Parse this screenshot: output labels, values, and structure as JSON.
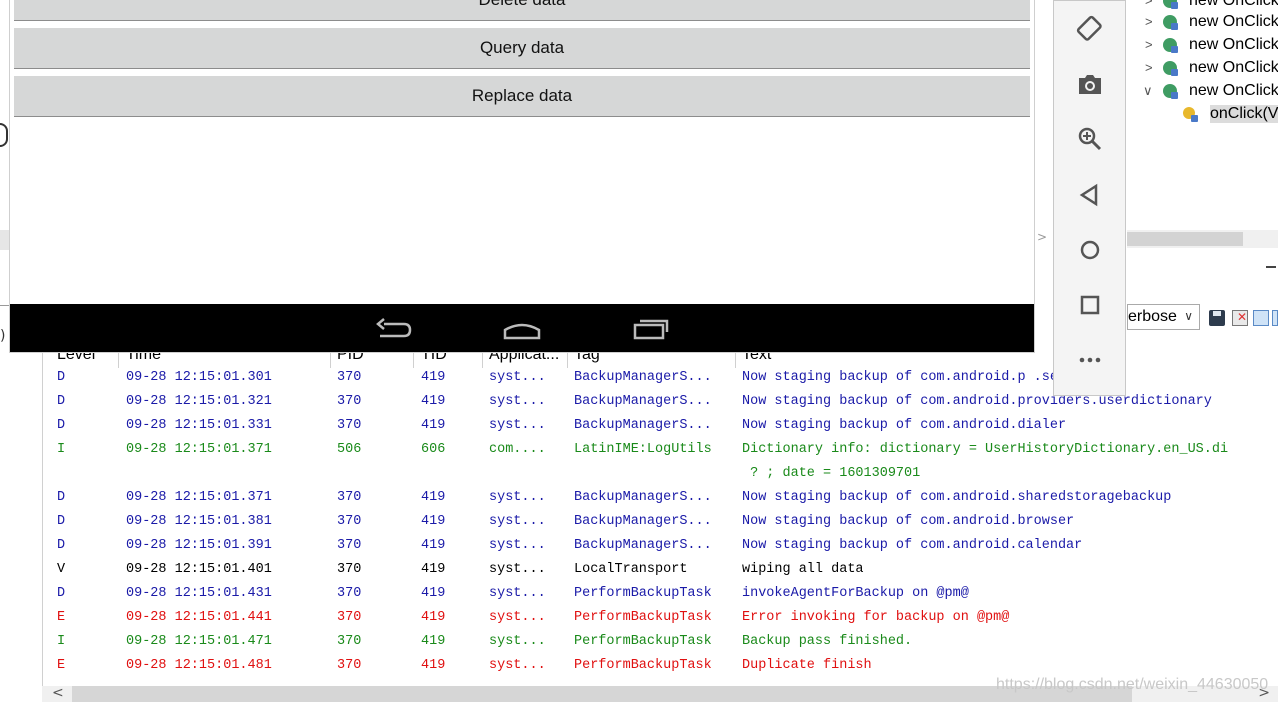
{
  "emulator": {
    "buttons": [
      {
        "label": "Delete data"
      },
      {
        "label": "Query data"
      },
      {
        "label": "Replace data"
      }
    ],
    "nav": [
      "back-icon",
      "home-icon",
      "recents-icon"
    ],
    "toolbar_icons": [
      "rotate-icon",
      "camera-icon",
      "zoom-icon",
      "back-triangle-icon",
      "home-circle-icon",
      "overview-square-icon",
      "more-icon"
    ]
  },
  "outline": {
    "items": [
      {
        "label": "new OnClick",
        "expanded": false
      },
      {
        "label": "new OnClick",
        "expanded": false
      },
      {
        "label": "new OnClick",
        "expanded": false
      },
      {
        "label": "new OnClick",
        "expanded": false
      },
      {
        "label": "new OnClick",
        "expanded": true
      },
      {
        "label": "onClick(V",
        "child": true
      }
    ]
  },
  "logcat": {
    "level_select": "erbose",
    "columns": [
      "Level",
      "Time",
      "PID",
      "TID",
      "Applicat...",
      "Tag",
      "Text"
    ],
    "rows": [
      {
        "level": "D",
        "time": "09-28 12:15:01.301",
        "pid": "370",
        "tid": "419",
        "app": "syst...",
        "tag": "BackupManagerS...",
        "text": "Now staging backup of com.android.p        .settings"
      },
      {
        "level": "D",
        "time": "09-28 12:15:01.321",
        "pid": "370",
        "tid": "419",
        "app": "syst...",
        "tag": "BackupManagerS...",
        "text": "Now staging backup of com.android.providers.userdictionary"
      },
      {
        "level": "D",
        "time": "09-28 12:15:01.331",
        "pid": "370",
        "tid": "419",
        "app": "syst...",
        "tag": "BackupManagerS...",
        "text": "Now staging backup of com.android.dialer"
      },
      {
        "level": "I",
        "time": "09-28 12:15:01.371",
        "pid": "506",
        "tid": "606",
        "app": "com....",
        "tag": "LatinIME:LogUtils",
        "text": "Dictionary info: dictionary = UserHistoryDictionary.en_US.di",
        "text2": " ? ; date = 1601309701"
      },
      {
        "level": "D",
        "time": "09-28 12:15:01.371",
        "pid": "370",
        "tid": "419",
        "app": "syst...",
        "tag": "BackupManagerS...",
        "text": "Now staging backup of com.android.sharedstoragebackup"
      },
      {
        "level": "D",
        "time": "09-28 12:15:01.381",
        "pid": "370",
        "tid": "419",
        "app": "syst...",
        "tag": "BackupManagerS...",
        "text": "Now staging backup of com.android.browser"
      },
      {
        "level": "D",
        "time": "09-28 12:15:01.391",
        "pid": "370",
        "tid": "419",
        "app": "syst...",
        "tag": "BackupManagerS...",
        "text": "Now staging backup of com.android.calendar"
      },
      {
        "level": "V",
        "time": "09-28 12:15:01.401",
        "pid": "370",
        "tid": "419",
        "app": "syst...",
        "tag": "LocalTransport",
        "text": "wiping all data"
      },
      {
        "level": "D",
        "time": "09-28 12:15:01.431",
        "pid": "370",
        "tid": "419",
        "app": "syst...",
        "tag": "PerformBackupTask",
        "text": "invokeAgentForBackup on @pm@"
      },
      {
        "level": "E",
        "time": "09-28 12:15:01.441",
        "pid": "370",
        "tid": "419",
        "app": "syst...",
        "tag": "PerformBackupTask",
        "text": "Error invoking for backup on @pm@"
      },
      {
        "level": "I",
        "time": "09-28 12:15:01.471",
        "pid": "370",
        "tid": "419",
        "app": "syst...",
        "tag": "PerformBackupTask",
        "text": "Backup pass finished."
      },
      {
        "level": "E",
        "time": "09-28 12:15:01.481",
        "pid": "370",
        "tid": "419",
        "app": "syst...",
        "tag": "PerformBackupTask",
        "text": "Duplicate finish"
      }
    ]
  },
  "watermark": "https://blog.csdn.net/weixin_44630050"
}
